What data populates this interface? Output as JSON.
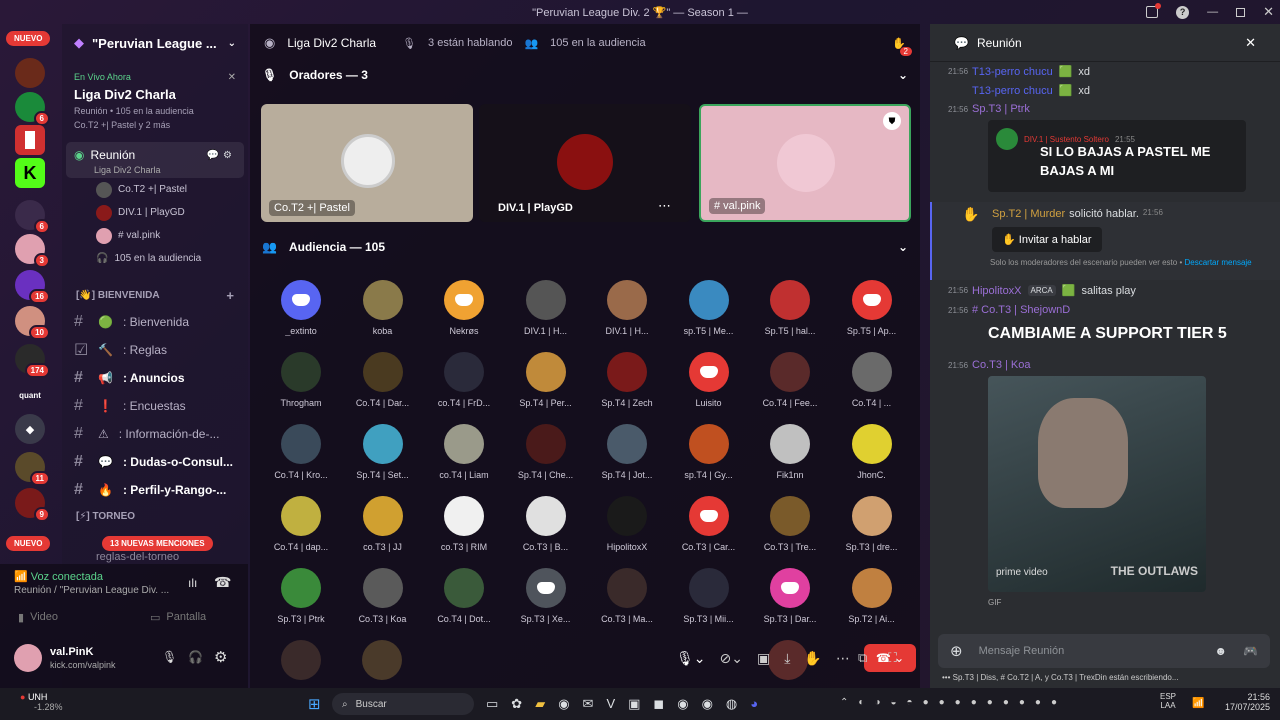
{
  "window": {
    "title": "\"Peruvian League Div. 2 🏆\" — Season 1 —"
  },
  "servers": {
    "new_top": "NUEVO",
    "new_bottom": "NUEVO",
    "badges": [
      "6",
      "6",
      "3",
      "16",
      "10",
      "174",
      "11",
      "9"
    ],
    "mentions_banner": "13 NUEVAS MENCIONES"
  },
  "guild": {
    "name": "\"Peruvian League ...",
    "live_label": "En Vivo Ahora",
    "live_title": "Liga Div2 Charla",
    "live_sub": "Reunión  •  105 en la audiencia",
    "live_people": "Co.T2 +| Pastel y 2 más"
  },
  "voice_channel": {
    "name": "Reunión",
    "sub": "Liga Div2 Charla",
    "members": [
      "Co.T2 +| Pastel",
      "DIV.1 | PlayGD",
      "# val.pink"
    ],
    "audience": "105 en la audiencia"
  },
  "categories": {
    "bienvenida": "BIENVENIDA",
    "torneo": "TORNEO"
  },
  "channels": [
    {
      "icon": "#",
      "emoji": "🟢",
      "label": ": Bienvenida",
      "bold": false
    },
    {
      "icon": "☑",
      "emoji": "🔨",
      "label": ": Reglas",
      "bold": false
    },
    {
      "icon": "#",
      "emoji": "📢",
      "label": ": Anuncios",
      "bold": true
    },
    {
      "icon": "#",
      "emoji": "❗",
      "label": ": Encuestas",
      "bold": false
    },
    {
      "icon": "#",
      "emoji": "⚠",
      "label": ": Información-de-...",
      "bold": false
    },
    {
      "icon": "#",
      "emoji": "💬",
      "label": ": Dudas-o-Consul...",
      "bold": true
    },
    {
      "icon": "#",
      "emoji": "🔥",
      "label": ": Perfil-y-Rango-...",
      "bold": true
    }
  ],
  "partial_channel": "reglas-del-torneo",
  "voice_status": {
    "label": "Voz conectada",
    "sub": "Reunión / \"Peruvian League Div. ...",
    "video": "Video",
    "screen": "Pantalla"
  },
  "user": {
    "name": "val.PinK",
    "status": "kick.com/valpink"
  },
  "stage": {
    "title": "Liga Div2 Charla",
    "talking": "3 están hablando",
    "audience": "105 en la audiencia",
    "hand_count": "2",
    "speakers_header": "Oradores — 3",
    "audience_header": "Audiencia — 105",
    "speakers": [
      {
        "label": "Co.T2 +| Pastel"
      },
      {
        "label": "DIV.1 | PlayGD"
      },
      {
        "label": "# val.pink"
      }
    ],
    "audience_list": [
      {
        "name": "_extinto",
        "color": "#5865f2",
        "discord": true
      },
      {
        "name": "koba",
        "color": "#8a7a4a"
      },
      {
        "name": "Nekrøs",
        "color": "#f0a232",
        "discord": true
      },
      {
        "name": "DIV.1 | H...",
        "color": "#555"
      },
      {
        "name": "DIV.1 | H...",
        "color": "#9a6a4a"
      },
      {
        "name": "sp.T5 | Me...",
        "color": "#3a8ac0"
      },
      {
        "name": "Sp.T5 | hal...",
        "color": "#c03030"
      },
      {
        "name": "Sp.T5 | Ap...",
        "color": "#e53935",
        "discord": true
      },
      {
        "name": "Throgham",
        "color": "#2a3a2a"
      },
      {
        "name": "Co.T4 | Dar...",
        "color": "#4a3a20"
      },
      {
        "name": "co.T4 | FrD...",
        "color": "#2a2a3a"
      },
      {
        "name": "Sp.T4 | Per...",
        "color": "#c08a3a"
      },
      {
        "name": "Sp.T4 | Zech",
        "color": "#7a1a1a"
      },
      {
        "name": "Luisito",
        "color": "#e53935",
        "discord": true
      },
      {
        "name": "Co.T4 | Fee...",
        "color": "#5a2a2a"
      },
      {
        "name": "Co.T4 | ...",
        "color": "#6a6a6a"
      },
      {
        "name": "Co.T4 | Kro...",
        "color": "#3a4a5a"
      },
      {
        "name": "Sp.T4 | Set...",
        "color": "#40a0c0"
      },
      {
        "name": "co.T4 | Liam",
        "color": "#9a9a8a"
      },
      {
        "name": "Sp.T4 | Che...",
        "color": "#4a1a1a"
      },
      {
        "name": "Sp.T4 | Jot...",
        "color": "#4a5a6a"
      },
      {
        "name": "sp.T4 | Gy...",
        "color": "#c05020"
      },
      {
        "name": "Fik1nn",
        "color": "#c0c0c0"
      },
      {
        "name": "JhonC.",
        "color": "#e0d030"
      },
      {
        "name": "Co.T4 | dap...",
        "color": "#c0b040"
      },
      {
        "name": "co.T3 | JJ",
        "color": "#d0a030"
      },
      {
        "name": "co.T3 | RIM",
        "color": "#f0f0f0"
      },
      {
        "name": "Co.T3 | B...",
        "color": "#e0e0e0"
      },
      {
        "name": "HipolitoxX",
        "color": "#1a1a1a"
      },
      {
        "name": "Co.T3 | Car...",
        "color": "#e53935",
        "discord": true
      },
      {
        "name": "Co.T3 | Tre...",
        "color": "#7a5a2a"
      },
      {
        "name": "Sp.T3 | dre...",
        "color": "#d0a070"
      },
      {
        "name": "Sp.T3 | Ptrk",
        "color": "#3a8a3a"
      },
      {
        "name": "Co.T3 | Koa",
        "color": "#5a5a5a"
      },
      {
        "name": "Co.T4 | Dot...",
        "color": "#3a5a3a"
      },
      {
        "name": "Sp.T3 | Xe...",
        "color": "#4f545c",
        "discord": true
      },
      {
        "name": "Co.T3 | Ma...",
        "color": "#3a2a2a"
      },
      {
        "name": "Sp.T3 | Mii...",
        "color": "#2a2a3a"
      },
      {
        "name": "Sp.T3 | Dar...",
        "color": "#e040a0",
        "discord": true
      },
      {
        "name": "Sp.T2 | Ai...",
        "color": "#c08040"
      }
    ]
  },
  "chat": {
    "title": "Reunión",
    "m1_time": "21:56",
    "m1_user": "T13-perro chucu",
    "m1_text": "xd",
    "m2_user": "T13-perro chucu",
    "m2_text": "xd",
    "m3_time": "21:56",
    "m3_user": "Sp.T3 | Ptrk",
    "quote_user": "DIV.1 | Sustento Soltero",
    "quote_time": "21:55",
    "quote_text": "SI LO BAJAS A PASTEL ME BAJAS A MI",
    "req_user": "Sp.T2 | Murder",
    "req_text": "solicitó hablar.",
    "req_time": "21:56",
    "invite": "Invitar a hablar",
    "mod_note": "Solo los moderadores del escenario pueden ver esto •",
    "dismiss": "Descartar mensaje",
    "m4_time": "21:56",
    "m4_user": "HipolitoxX",
    "m4_tag": "ARCA",
    "m4_text": "salitas play",
    "m5_time": "21:56",
    "m5_user": "# Co.T3 | ShejownD",
    "m5_text": "CAMBIAME A SUPPORT TIER 5",
    "m6_time": "21:56",
    "m6_user": "Co.T3 | Koa",
    "gif_brand": "prime video",
    "gif_title": "THE OUTLAWS",
    "gif": "GIF",
    "input_placeholder": "Mensaje Reunión",
    "typing": "Sp.T3 | Diss, # Co.T2 | A, y  Co.T3 | TrexDin están escribiendo..."
  },
  "taskbar": {
    "ticker": "UNH",
    "change": "-1.28%",
    "search": "Buscar",
    "lang": "ESP",
    "lang2": "LAA",
    "time": "21:56",
    "date": "17/07/2025"
  }
}
